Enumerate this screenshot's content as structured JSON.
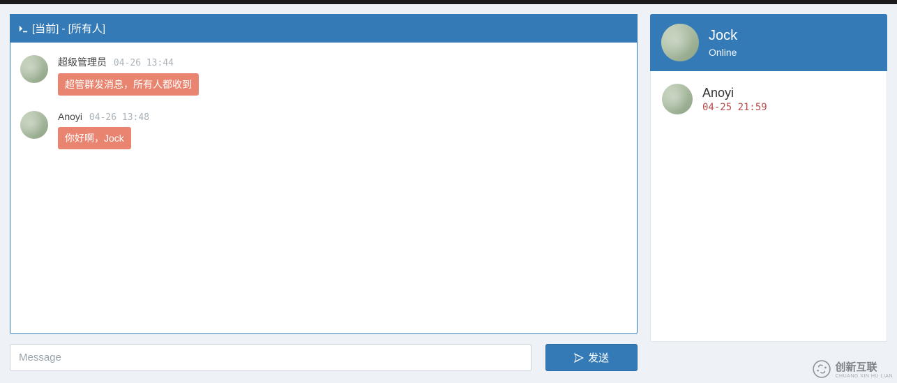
{
  "header": {
    "title_prefix": "[当前]",
    "title_suffix": "[所有人]",
    "icon": "terminal-icon"
  },
  "messages": [
    {
      "author": "超级管理员",
      "time": "04-26 13:44",
      "text": "超管群发消息，所有人都收到"
    },
    {
      "author": "Anoyi",
      "time": "04-26 13:48",
      "text": "你好啊，Jock"
    }
  ],
  "compose": {
    "placeholder": "Message",
    "send_label": "发送"
  },
  "me": {
    "name": "Jock",
    "status": "Online"
  },
  "contacts": [
    {
      "name": "Anoyi",
      "time": "04-25 21:59"
    }
  ],
  "watermark": {
    "brand": "创新互联",
    "sub": "CHUANG XIN HU LIAN"
  }
}
